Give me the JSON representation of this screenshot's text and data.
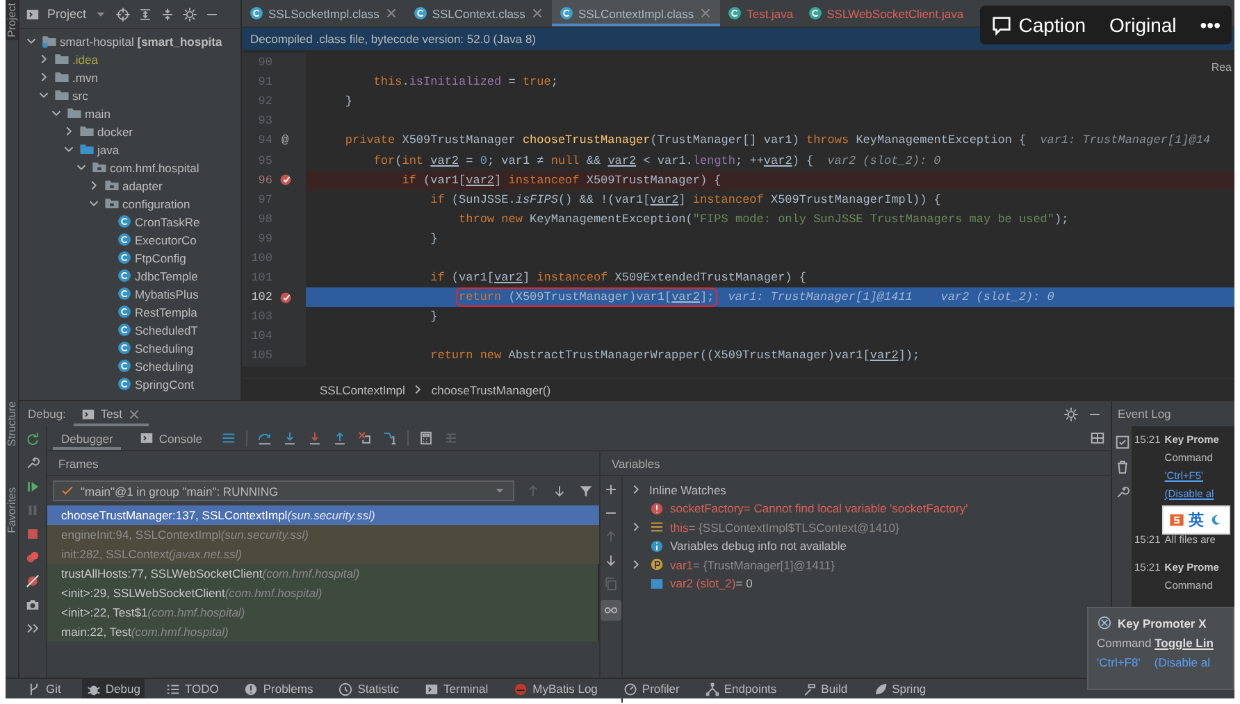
{
  "left_stripe": {
    "labels": [
      "Project",
      "Structure",
      "Favorites"
    ]
  },
  "project": {
    "title": "Project",
    "tree": [
      {
        "label": "smart-hospital **[smart_hospita**",
        "kind": "module",
        "ignored": false,
        "expanded": true,
        "children": [
          {
            "label": ".idea",
            "kind": "folder",
            "ignored": true,
            "expanded": false
          },
          {
            "label": ".mvn",
            "kind": "folder",
            "ignored": false,
            "expanded": false
          },
          {
            "label": "src",
            "kind": "folder",
            "ignored": false,
            "expanded": true,
            "children": [
              {
                "label": "main",
                "kind": "folder",
                "ignored": false,
                "expanded": true,
                "children": [
                  {
                    "label": "docker",
                    "kind": "folder",
                    "ignored": false,
                    "expanded": false
                  },
                  {
                    "label": "java",
                    "kind": "source",
                    "ignored": false,
                    "expanded": true,
                    "children": [
                      {
                        "label": "com.hmf.hospital",
                        "kind": "package",
                        "ignored": false,
                        "expanded": true,
                        "children": [
                          {
                            "label": "adapter",
                            "kind": "package",
                            "ignored": false,
                            "expanded": false
                          },
                          {
                            "label": "configuration",
                            "kind": "package",
                            "ignored": false,
                            "expanded": true,
                            "children": [
                              {
                                "label": "CronTaskRe",
                                "kind": "class",
                                "ignored": false
                              },
                              {
                                "label": "ExecutorCo",
                                "kind": "class",
                                "ignored": false
                              },
                              {
                                "label": "FtpConfig",
                                "kind": "class",
                                "ignored": false
                              },
                              {
                                "label": "JdbcTemple",
                                "kind": "class",
                                "ignored": false
                              },
                              {
                                "label": "MybatisPlus",
                                "kind": "class",
                                "ignored": false
                              },
                              {
                                "label": "RestTempla",
                                "kind": "class",
                                "ignored": false
                              },
                              {
                                "label": "ScheduledT",
                                "kind": "class",
                                "ignored": false
                              },
                              {
                                "label": "Scheduling",
                                "kind": "class",
                                "ignored": false
                              },
                              {
                                "label": "Scheduling",
                                "kind": "class",
                                "ignored": false
                              },
                              {
                                "label": "SpringCont",
                                "kind": "class",
                                "ignored": false
                              }
                            ]
                          }
                        ]
                      }
                    ]
                  }
                ]
              }
            ]
          }
        ]
      }
    ]
  },
  "editor": {
    "tabs": [
      {
        "label": "SSLSocketImpl.class",
        "kind": "class",
        "color": "#a9b7c6",
        "selected": false
      },
      {
        "label": "SSLContext.class",
        "kind": "class",
        "color": "#a9b7c6",
        "selected": false
      },
      {
        "label": "SSLContextImpl.class",
        "kind": "class",
        "color": "#a9b7c6",
        "selected": true
      },
      {
        "label": "Test.java",
        "kind": "java",
        "color": "#d9605a",
        "selected": false
      },
      {
        "label": "SSLWebSocketClient.java",
        "kind": "java",
        "color": "#d9605a",
        "selected": false
      }
    ],
    "banner": "Decompiled .class file, bytecode version: 52.0 (Java 8)",
    "reader_mode": "Rea",
    "lines": [
      {
        "number": "90",
        "breakpoint": false,
        "current": false
      },
      {
        "number": "91",
        "breakpoint": false,
        "current": false,
        "tokens": [
          {
            "kind": "kw",
            "text": "        this"
          },
          {
            "kind": "plain",
            "text": "."
          },
          {
            "kind": "field",
            "text": "isInitialized"
          },
          {
            "kind": "plain",
            "text": " = "
          },
          {
            "kind": "kw",
            "text": "true"
          },
          {
            "kind": "plain",
            "text": ";"
          }
        ]
      },
      {
        "number": "92",
        "breakpoint": false,
        "current": false,
        "tokens": [
          {
            "kind": "plain",
            "text": "    }"
          }
        ]
      },
      {
        "number": "93",
        "breakpoint": false,
        "current": false
      },
      {
        "number": "94",
        "marker": "@",
        "breakpoint": false,
        "current": false,
        "tokens": [
          {
            "kind": "kw",
            "text": "    private "
          },
          {
            "kind": "plain",
            "text": "X509TrustManager "
          },
          {
            "kind": "method",
            "text": "chooseTrustManager"
          },
          {
            "kind": "plain",
            "text": "(TrustManager[] var1) "
          },
          {
            "kind": "kw",
            "text": "throws "
          },
          {
            "kind": "plain",
            "text": "KeyManagementException {"
          }
        ],
        "hint": "var1: TrustManager[1]@14"
      },
      {
        "number": "95",
        "breakpoint": false,
        "current": false,
        "tokens": [
          {
            "kind": "kw",
            "text": "        for"
          },
          {
            "kind": "plain",
            "text": "("
          },
          {
            "kind": "kw",
            "text": "int "
          },
          {
            "kind": "var",
            "text": "var2"
          },
          {
            "kind": "plain",
            "text": " = "
          },
          {
            "kind": "num",
            "text": "0"
          },
          {
            "kind": "plain",
            "text": "; var1 ≠ "
          },
          {
            "kind": "kw",
            "text": "null"
          },
          {
            "kind": "plain",
            "text": " && "
          },
          {
            "kind": "var",
            "text": "var2"
          },
          {
            "kind": "plain",
            "text": " < var1."
          },
          {
            "kind": "field",
            "text": "length"
          },
          {
            "kind": "plain",
            "text": "; ++"
          },
          {
            "kind": "var",
            "text": "var2"
          },
          {
            "kind": "plain",
            "text": ") {"
          }
        ],
        "hint": "var2 (slot_2): 0"
      },
      {
        "number": "96",
        "breakpoint": true,
        "current": false,
        "tokens": [
          {
            "kind": "kw",
            "text": "            if "
          },
          {
            "kind": "plain",
            "text": "(var1["
          },
          {
            "kind": "var",
            "text": "var2"
          },
          {
            "kind": "plain",
            "text": "] "
          },
          {
            "kind": "kw",
            "text": "instanceof "
          },
          {
            "kind": "plain",
            "text": "X509TrustManager) {"
          }
        ]
      },
      {
        "number": "97",
        "breakpoint": false,
        "current": false,
        "tokens": [
          {
            "kind": "kw",
            "text": "                if "
          },
          {
            "kind": "plain",
            "text": "(SunJSSE."
          },
          {
            "kind": "static",
            "text": "isFIPS"
          },
          {
            "kind": "plain",
            "text": "() && !(var1["
          },
          {
            "kind": "var",
            "text": "var2"
          },
          {
            "kind": "plain",
            "text": "] "
          },
          {
            "kind": "kw",
            "text": "instanceof "
          },
          {
            "kind": "plain",
            "text": "X509TrustManagerImpl)) {"
          }
        ]
      },
      {
        "number": "98",
        "breakpoint": false,
        "current": false,
        "tokens": [
          {
            "kind": "kw",
            "text": "                    throw new "
          },
          {
            "kind": "plain",
            "text": "KeyManagementException("
          },
          {
            "kind": "str",
            "text": "\"FIPS mode: only SunJSSE TrustManagers may be used\""
          },
          {
            "kind": "plain",
            "text": ");"
          }
        ]
      },
      {
        "number": "99",
        "breakpoint": false,
        "current": false,
        "tokens": [
          {
            "kind": "plain",
            "text": "                }"
          }
        ]
      },
      {
        "number": "100",
        "breakpoint": false,
        "current": false
      },
      {
        "number": "101",
        "breakpoint": false,
        "current": false,
        "tokens": [
          {
            "kind": "kw",
            "text": "                if "
          },
          {
            "kind": "plain",
            "text": "(var1["
          },
          {
            "kind": "var",
            "text": "var2"
          },
          {
            "kind": "plain",
            "text": "] "
          },
          {
            "kind": "kw",
            "text": "instanceof "
          },
          {
            "kind": "plain",
            "text": "X509ExtendedTrustManager) {"
          }
        ]
      },
      {
        "number": "102",
        "breakpoint": true,
        "current": true,
        "tokens": [
          {
            "kind": "kw",
            "text": "                    return ",
            "boxed": true
          },
          {
            "kind": "plain",
            "text": "(X509TrustManager)var1[",
            "boxed": true
          },
          {
            "kind": "var",
            "text": "var2",
            "boxed": true
          },
          {
            "kind": "plain",
            "text": "];",
            "boxed": true
          }
        ],
        "hint": "var1: TrustManager[1]@1411    var2 (slot_2): 0"
      },
      {
        "number": "103",
        "breakpoint": false,
        "current": false,
        "tokens": [
          {
            "kind": "plain",
            "text": "                }"
          }
        ]
      },
      {
        "number": "104",
        "breakpoint": false,
        "current": false
      },
      {
        "number": "105",
        "breakpoint": false,
        "current": false,
        "tokens": [
          {
            "kind": "kw",
            "text": "                return new "
          },
          {
            "kind": "plain",
            "text": "AbstractTrustManagerWrapper((X509TrustManager)var1["
          },
          {
            "kind": "var",
            "text": "var2"
          },
          {
            "kind": "plain",
            "text": "]);"
          }
        ]
      }
    ],
    "breadcrumbs": [
      "SSLContextImpl",
      "chooseTrustManager()"
    ]
  },
  "debug": {
    "label": "Debug:",
    "tabs": [
      {
        "label": "Test",
        "selected": true
      }
    ],
    "subtabs": [
      {
        "label": "Debugger",
        "kind": "debugger",
        "selected": true
      },
      {
        "label": "Console",
        "kind": "console",
        "selected": false
      }
    ],
    "frames": {
      "title": "Frames",
      "thread": "\"main\"@1 in group \"main\": RUNNING",
      "rows": [
        {
          "method": "chooseTrustManager:137, SSLContextImpl",
          "package": "(sun.security.ssl)",
          "kind": "library",
          "selected": true
        },
        {
          "method": "engineInit:94, SSLContextImpl",
          "package": "(sun.security.ssl)",
          "kind": "library",
          "selected": false
        },
        {
          "method": "init:282, SSLContext",
          "package": "(javax.net.ssl)",
          "kind": "library",
          "selected": false
        },
        {
          "method": "trustAllHosts:77, SSLWebSocketClient",
          "package": "(com.hmf.hospital)",
          "kind": "project",
          "selected": false
        },
        {
          "method": "<init>:29, SSLWebSocketClient",
          "package": "(com.hmf.hospital)",
          "kind": "project",
          "selected": false
        },
        {
          "method": "<init>:22, Test$1",
          "package": "(com.hmf.hospital)",
          "kind": "project",
          "selected": false
        },
        {
          "method": "main:22, Test",
          "package": "(com.hmf.hospital)",
          "kind": "project",
          "selected": false
        }
      ]
    },
    "variables": {
      "title": "Variables",
      "items": [
        {
          "kind": "watches",
          "name": "Inline Watches",
          "has_children": true
        },
        {
          "kind": "error",
          "name": "socketFactory",
          "value": "= Cannot find local variable 'socketFactory'",
          "has_children": false
        },
        {
          "kind": "object",
          "name": "this",
          "value": "= {SSLContextImpl$TLSContext@1410}",
          "has_children": true
        },
        {
          "kind": "info",
          "name": "Variables debug info not available",
          "has_children": false
        },
        {
          "kind": "param",
          "name": "var1",
          "value": "= {TrustManager[1]@1411}",
          "has_children": true
        },
        {
          "kind": "primitive",
          "name": "var2 (slot_2)",
          "value": "= 0",
          "has_children": false
        }
      ]
    }
  },
  "event_log": {
    "title": "Event Log",
    "entries": [
      {
        "time": "15:21",
        "lines": [
          {
            "kind": "title",
            "text": "Key Prome"
          },
          {
            "kind": "text",
            "text": "Command"
          },
          {
            "kind": "link",
            "text": "'Ctrl+F5'"
          },
          {
            "kind": "link",
            "text": "(Disable al"
          }
        ]
      },
      {
        "time": "15:21",
        "lines": [
          {
            "kind": "text",
            "text": "All files are"
          }
        ]
      },
      {
        "time": "15:21",
        "lines": [
          {
            "kind": "title",
            "text": "Key Prome"
          },
          {
            "kind": "text",
            "text": "Command"
          }
        ]
      }
    ]
  },
  "key_promoter_popup": {
    "title": "Key Promoter X",
    "message": "Command **Toggle Lin**",
    "shortcut": "'Ctrl+F8'",
    "action": "(Disable al"
  },
  "ime_toolbar": {
    "label": "英"
  },
  "viewer_toolbar": {
    "buttons": [
      {
        "label": "Caption",
        "kind": "caption"
      },
      {
        "label": "Original",
        "kind": "plain"
      },
      {
        "label": "•••",
        "kind": "plain"
      }
    ]
  },
  "status_bar": [
    {
      "label": "Git",
      "kind": "git",
      "selected": false
    },
    {
      "label": "Debug",
      "kind": "debug",
      "selected": true
    },
    {
      "label": "TODO",
      "kind": "todo",
      "selected": false
    },
    {
      "label": "Problems",
      "kind": "problems",
      "selected": false
    },
    {
      "label": "Statistic",
      "kind": "statistic",
      "selected": false
    },
    {
      "label": "Terminal",
      "kind": "terminal",
      "selected": false
    },
    {
      "label": "MyBatis Log",
      "kind": "mybatis",
      "selected": false
    },
    {
      "label": "Profiler",
      "kind": "profiler",
      "selected": false
    },
    {
      "label": "Endpoints",
      "kind": "endpoints",
      "selected": false
    },
    {
      "label": "Build",
      "kind": "build",
      "selected": false
    },
    {
      "label": "Spring",
      "kind": "spring",
      "selected": false
    }
  ]
}
